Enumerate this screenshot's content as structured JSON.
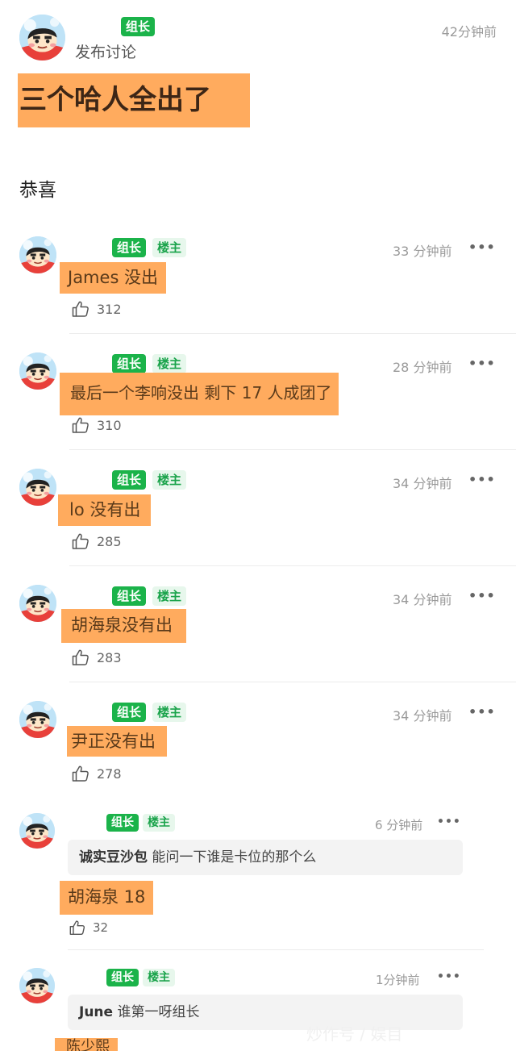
{
  "post": {
    "action": "发布讨论",
    "badge_leader": "组长",
    "time": "42分钟前",
    "title": "三个哈人全出了",
    "body": "恭喜"
  },
  "labels": {
    "leader": "组长",
    "op": "楼主",
    "more": "•••"
  },
  "comments": [
    {
      "time": "33 分钟前",
      "text": "James 没出",
      "likes": "312"
    },
    {
      "time": "28 分钟前",
      "text": "最后一个李响没出 剩下 17 人成团了",
      "likes": "310"
    },
    {
      "time": "34 分钟前",
      "text": "lo 没有出",
      "likes": "285"
    },
    {
      "time": "34 分钟前",
      "text": "胡海泉没有出",
      "likes": "283"
    },
    {
      "time": "34 分钟前",
      "text": "尹正没有出",
      "likes": "278"
    },
    {
      "time": "6 分钟前",
      "quote_user": "诚实豆沙包",
      "quote_text": "能问一下谁是卡位的那个么",
      "text": "胡海泉 18",
      "likes": "32"
    },
    {
      "time": "1分钟前",
      "quote_user": "June",
      "quote_text": "谁第一呀组长",
      "text": "陈少熙"
    }
  ],
  "watermark": "炒作号 / 娱目"
}
